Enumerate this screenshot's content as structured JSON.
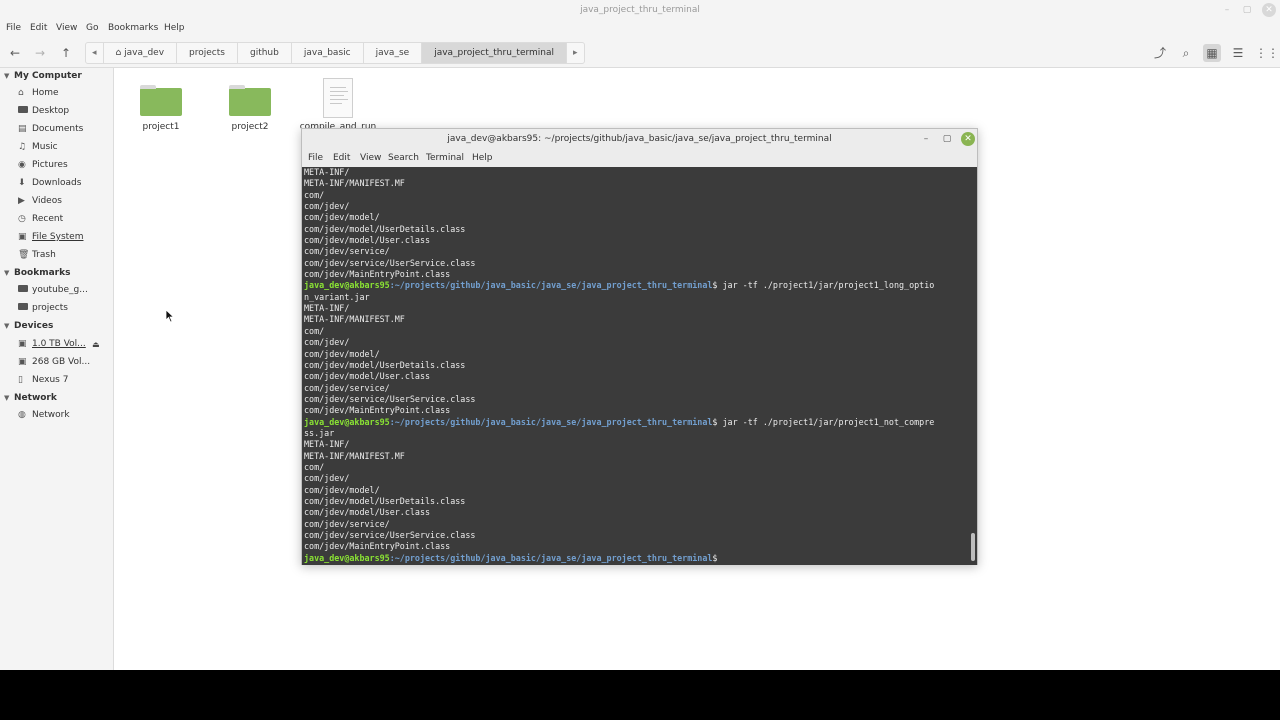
{
  "file_manager": {
    "title": "java_project_thru_terminal",
    "menu": [
      "File",
      "Edit",
      "View",
      "Go",
      "Bookmarks",
      "Help"
    ],
    "breadcrumbs": [
      "java_dev",
      "projects",
      "github",
      "java_basic",
      "java_se",
      "java_project_thru_terminal"
    ],
    "active_crumb": "java_project_thru_terminal"
  },
  "sidebar": {
    "sections": {
      "my_computer": "My Computer",
      "bookmarks": "Bookmarks",
      "devices": "Devices",
      "network": "Network"
    },
    "my_computer_items": [
      "Home",
      "Desktop",
      "Documents",
      "Music",
      "Pictures",
      "Downloads",
      "Videos",
      "Recent",
      "File System",
      "Trash"
    ],
    "bookmark_items": [
      "youtube_g...",
      "projects"
    ],
    "device_items": [
      "1.0 TB Vol...",
      "268 GB Vol...",
      "Nexus 7"
    ],
    "network_items": [
      "Network"
    ]
  },
  "content": {
    "items": [
      {
        "name": "project1",
        "icon": "folder-icon"
      },
      {
        "name": "project2",
        "icon": "folder-icon"
      },
      {
        "name": "compile_and_run",
        "icon": "document-icon"
      }
    ]
  },
  "terminal": {
    "title": "java_dev@akbars95: ~/projects/github/java_basic/java_se/java_project_thru_terminal",
    "menu": [
      "File",
      "Edit",
      "View",
      "Search",
      "Terminal",
      "Help"
    ],
    "prompt_user": "java_dev@akbars95",
    "prompt_path": ":~/projects/github/java_basic/java_se/java_project_thru_terminal",
    "lines": [
      {
        "type": "out",
        "text": "META-INF/"
      },
      {
        "type": "out",
        "text": "META-INF/MANIFEST.MF"
      },
      {
        "type": "out",
        "text": "com/"
      },
      {
        "type": "out",
        "text": "com/jdev/"
      },
      {
        "type": "out",
        "text": "com/jdev/model/"
      },
      {
        "type": "out",
        "text": "com/jdev/model/UserDetails.class"
      },
      {
        "type": "out",
        "text": "com/jdev/model/User.class"
      },
      {
        "type": "out",
        "text": "com/jdev/service/"
      },
      {
        "type": "out",
        "text": "com/jdev/service/UserService.class"
      },
      {
        "type": "out",
        "text": "com/jdev/MainEntryPoint.class"
      },
      {
        "type": "prompt",
        "cmd": "$ jar -tf ./project1/jar/project1_long_optio"
      },
      {
        "type": "out",
        "text": "n_variant.jar"
      },
      {
        "type": "out",
        "text": "META-INF/"
      },
      {
        "type": "out",
        "text": "META-INF/MANIFEST.MF"
      },
      {
        "type": "out",
        "text": "com/"
      },
      {
        "type": "out",
        "text": "com/jdev/"
      },
      {
        "type": "out",
        "text": "com/jdev/model/"
      },
      {
        "type": "out",
        "text": "com/jdev/model/UserDetails.class"
      },
      {
        "type": "out",
        "text": "com/jdev/model/User.class"
      },
      {
        "type": "out",
        "text": "com/jdev/service/"
      },
      {
        "type": "out",
        "text": "com/jdev/service/UserService.class"
      },
      {
        "type": "out",
        "text": "com/jdev/MainEntryPoint.class"
      },
      {
        "type": "prompt",
        "cmd": "$ jar -tf ./project1/jar/project1_not_compre"
      },
      {
        "type": "out",
        "text": "ss.jar"
      },
      {
        "type": "out",
        "text": "META-INF/"
      },
      {
        "type": "out",
        "text": "META-INF/MANIFEST.MF"
      },
      {
        "type": "out",
        "text": "com/"
      },
      {
        "type": "out",
        "text": "com/jdev/"
      },
      {
        "type": "out",
        "text": "com/jdev/model/"
      },
      {
        "type": "out",
        "text": "com/jdev/model/UserDetails.class"
      },
      {
        "type": "out",
        "text": "com/jdev/model/User.class"
      },
      {
        "type": "out",
        "text": "com/jdev/service/"
      },
      {
        "type": "out",
        "text": "com/jdev/service/UserService.class"
      },
      {
        "type": "out",
        "text": "com/jdev/MainEntryPoint.class"
      },
      {
        "type": "prompt",
        "cmd": "$"
      }
    ]
  },
  "colors": {
    "folder": "#88b95c",
    "terminal_bg": "#3b3b3b",
    "prompt_user": "#8ae234",
    "prompt_path": "#729fcf",
    "close_button": "#8ab452"
  }
}
